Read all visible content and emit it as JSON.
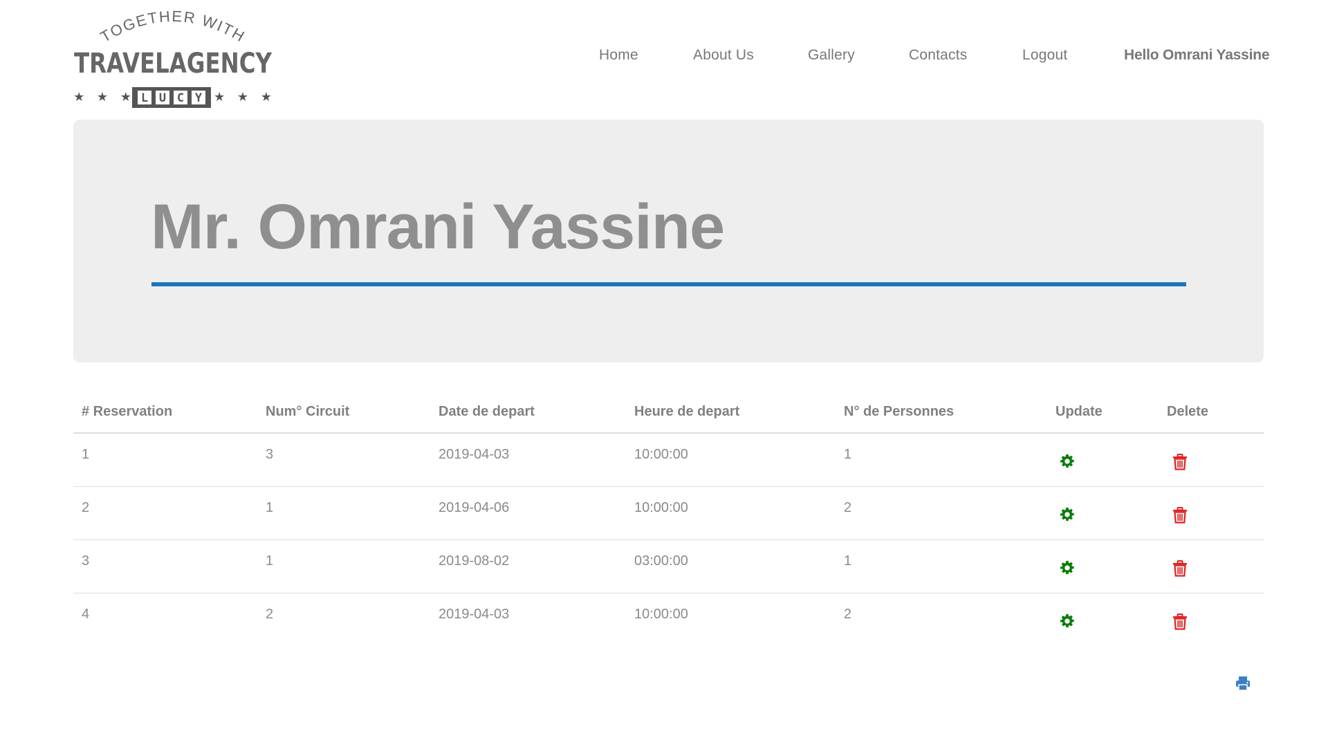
{
  "logo": {
    "arc_text": "TOGETHER WITH",
    "brand": "TRAVELAGENCY",
    "badge_letters": [
      "L",
      "U",
      "C",
      "Y"
    ],
    "stars": "★ ★ ★"
  },
  "nav": {
    "items": [
      {
        "label": "Home"
      },
      {
        "label": "About Us"
      },
      {
        "label": "Gallery"
      },
      {
        "label": "Contacts"
      },
      {
        "label": "Logout"
      }
    ],
    "greeting": "Hello Omrani Yassine"
  },
  "jumbotron": {
    "title": "Mr. Omrani Yassine"
  },
  "table": {
    "headers": [
      "# Reservation",
      "Num° Circuit",
      "Date de depart",
      "Heure de depart",
      "N° de Personnes",
      "Update",
      "Delete"
    ],
    "rows": [
      {
        "reservation": "1",
        "circuit": "3",
        "date": "2019-04-03",
        "time": "10:00:00",
        "persons": "1"
      },
      {
        "reservation": "2",
        "circuit": "1",
        "date": "2019-04-06",
        "time": "10:00:00",
        "persons": "2"
      },
      {
        "reservation": "3",
        "circuit": "1",
        "date": "2019-08-02",
        "time": "03:00:00",
        "persons": "1"
      },
      {
        "reservation": "4",
        "circuit": "2",
        "date": "2019-04-03",
        "time": "10:00:00",
        "persons": "2"
      }
    ],
    "update_icon": "gear-icon",
    "delete_icon": "trash-icon"
  },
  "print_icon": "printer-icon",
  "colors": {
    "accent_rule": "#1b75bc",
    "update_icon": "#0a7d0a",
    "delete_icon": "#e02020",
    "print_icon": "#3a80c9",
    "jumbotron_bg": "#eeeeee"
  }
}
